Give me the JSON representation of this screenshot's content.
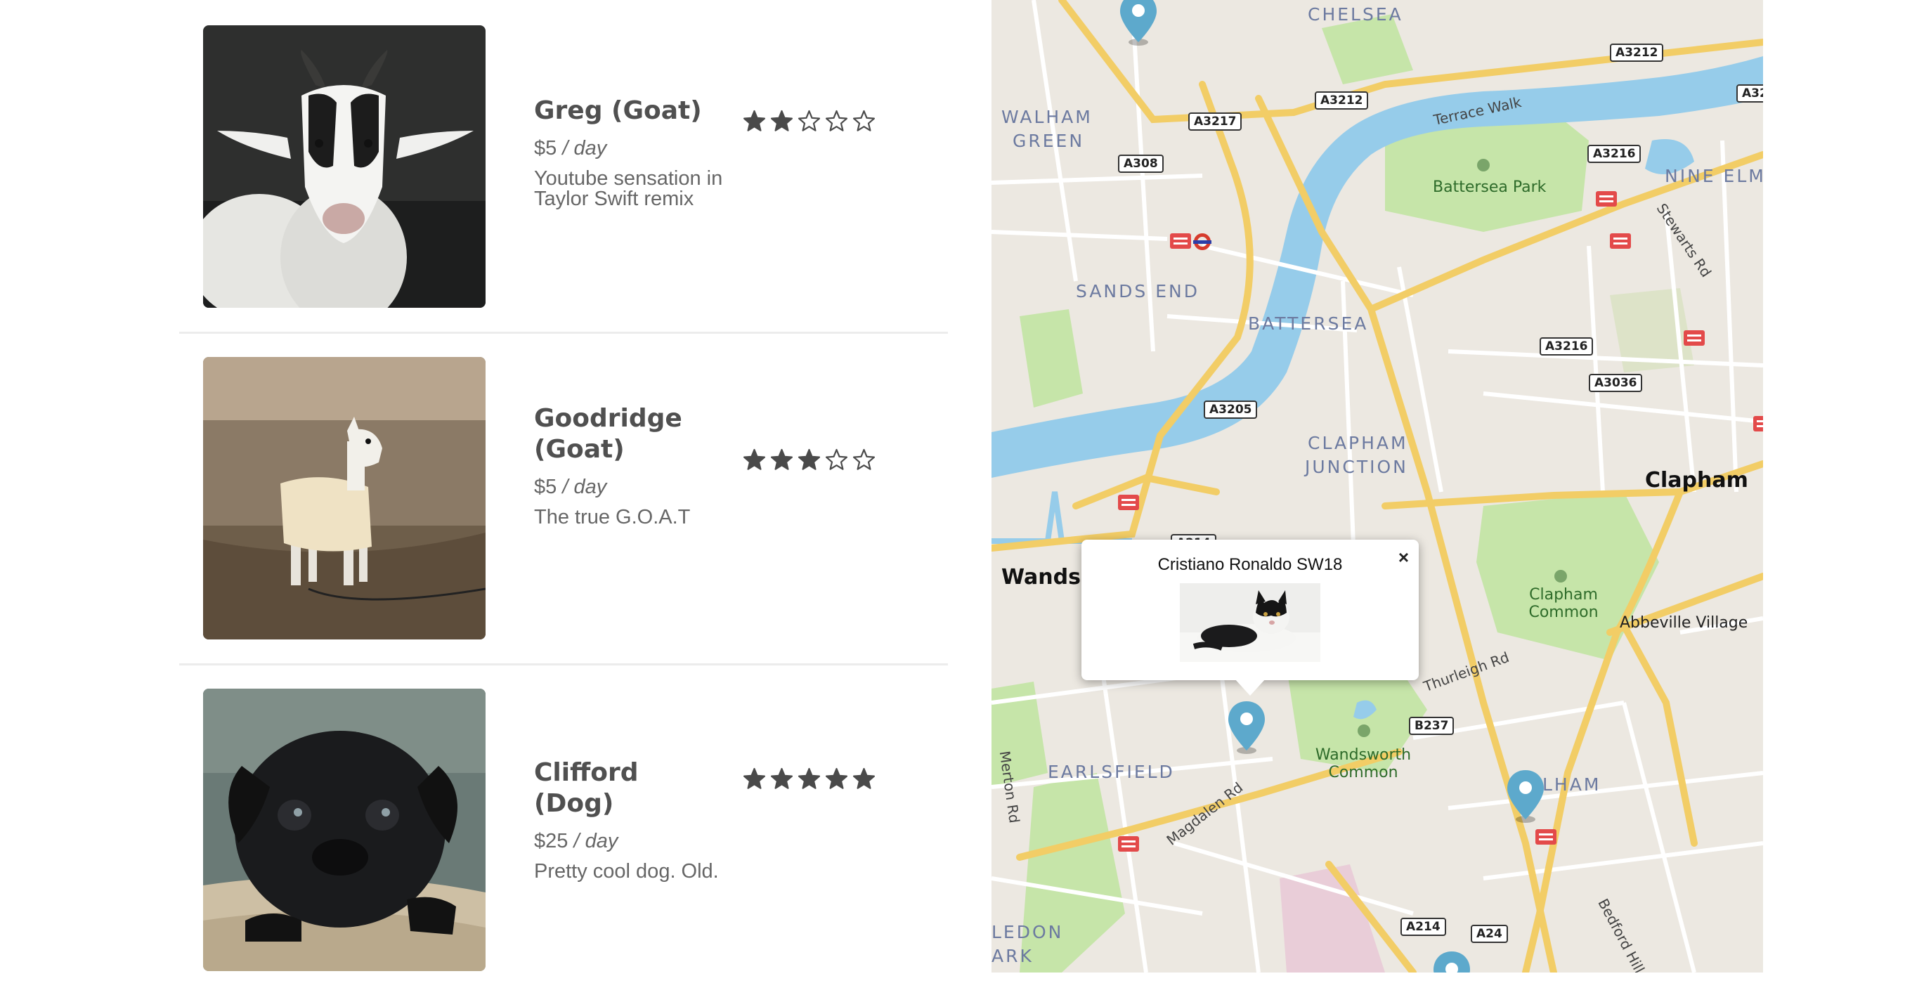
{
  "listings": [
    {
      "name": "Greg (Goat)",
      "price": "$5",
      "unit": "/ day",
      "description": "Youtube sensation in Taylor Swift remix",
      "rating": 2,
      "max_rating": 5,
      "photo": "goat-photo"
    },
    {
      "name": "Goodridge (Goat)",
      "price": "$5",
      "unit": "/ day",
      "description": "The true G.O.A.T",
      "rating": 3,
      "max_rating": 5,
      "photo": "goat-in-jacket-photo"
    },
    {
      "name": "Clifford (Dog)",
      "price": "$25",
      "unit": "/ day",
      "description": "Pretty cool dog. Old.",
      "rating": 5,
      "max_rating": 5,
      "photo": "pug-photo"
    }
  ],
  "map": {
    "popup": {
      "title": "Cristiano Ronaldo SW18",
      "close": "×",
      "image": "cat-photo"
    },
    "districts": [
      "CHELSEA",
      "WALHAM",
      "GREEN",
      "NINE ELM",
      "SANDS END",
      "BATTERSEA",
      "CLAPHAM",
      "JUNCTION",
      "EARLSFIELD",
      "LHAM",
      "LEDON",
      "ARK"
    ],
    "places": [
      "Clapham",
      "Wandsw",
      "Abbeville Village"
    ],
    "parks": [
      "Battersea Park",
      "Clapham Common",
      "Wandsworth Common"
    ],
    "streets": [
      "Terrace Walk",
      "Stewarts Rd",
      "Thurleigh Rd",
      "Magdalen Rd",
      "Merton Rd",
      "Bedford Hill"
    ],
    "roads": [
      "A3212",
      "A3212",
      "A32",
      "A3217",
      "A308",
      "A3216",
      "A3216",
      "A3036",
      "A3205",
      "A214",
      "B237",
      "A214",
      "A24"
    ],
    "colors": {
      "water": "#96ccea",
      "park": "#c6e5a9",
      "road_major": "#f2cd66",
      "land": "#ece8e1",
      "pin": "#5da9cc",
      "star": "#4a4a4a"
    }
  }
}
